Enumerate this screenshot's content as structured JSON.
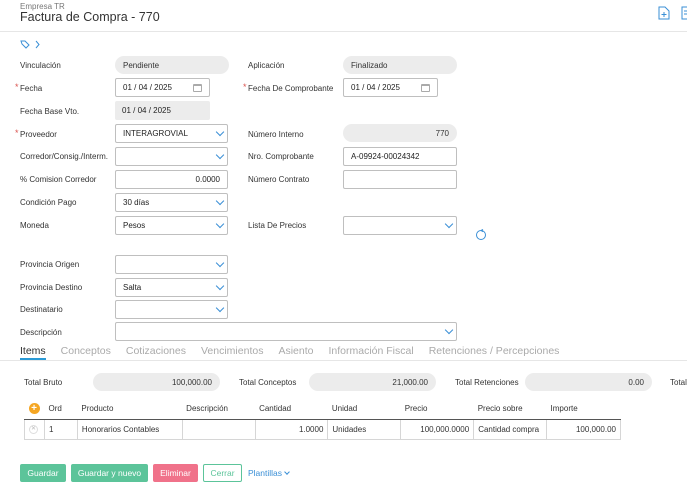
{
  "header": {
    "company": "Empresa TR",
    "title": "Factura de Compra - 770"
  },
  "form": {
    "vinculacion": {
      "label": "Vinculación",
      "value": "Pendiente"
    },
    "aplicacion": {
      "label": "Aplicación",
      "value": "Finalizado"
    },
    "fecha": {
      "label": "Fecha",
      "value": "01 / 04 / 2025"
    },
    "fecha_comprobante": {
      "label": "Fecha De Comprobante",
      "value": "01 / 04 / 2025"
    },
    "fecha_base_vto": {
      "label": "Fecha Base Vto.",
      "value": "01 / 04 / 2025"
    },
    "proveedor": {
      "label": "Proveedor",
      "value": "INTERAGROVIAL"
    },
    "numero_interno": {
      "label": "Número Interno",
      "value": "770"
    },
    "corredor": {
      "label": "Corredor/Consig./Interm.",
      "value": ""
    },
    "nro_comprobante": {
      "label": "Nro. Comprobante",
      "value": "A-09924-00024342"
    },
    "comision_corredor": {
      "label": "% Comision Corredor",
      "value": "0.0000"
    },
    "numero_contrato": {
      "label": "Número Contrato",
      "value": ""
    },
    "condicion_pago": {
      "label": "Condición Pago",
      "value": "30 días"
    },
    "moneda": {
      "label": "Moneda",
      "value": "Pesos"
    },
    "lista_precios": {
      "label": "Lista De Precios",
      "value": ""
    },
    "provincia_origen": {
      "label": "Provincia Origen",
      "value": ""
    },
    "provincia_destino": {
      "label": "Provincia Destino",
      "value": "Salta"
    },
    "destinatario": {
      "label": "Destinatario",
      "value": ""
    },
    "descripcion": {
      "label": "Descripción",
      "value": ""
    }
  },
  "tabs": [
    "Items",
    "Conceptos",
    "Cotizaciones",
    "Vencimientos",
    "Asiento",
    "Información Fiscal",
    "Retenciones / Percepciones"
  ],
  "totals": {
    "bruto": {
      "label": "Total Bruto",
      "value": "100,000.00"
    },
    "conceptos": {
      "label": "Total Conceptos",
      "value": "21,000.00"
    },
    "retenciones": {
      "label": "Total Retenciones",
      "value": "0.00"
    },
    "total": {
      "label": "Total",
      "value": ""
    }
  },
  "items_table": {
    "columns": [
      "Ord",
      "Producto",
      "Descripción",
      "Cantidad",
      "Unidad",
      "Precio",
      "Precio sobre",
      "Importe"
    ],
    "rows": [
      {
        "ord": "1",
        "producto": "Honorarios Contables",
        "descripcion": "",
        "cantidad": "1.0000",
        "unidad": "Unidades",
        "precio": "100,000.0000",
        "precio_sobre": "Cantidad compra",
        "importe": "100,000.00"
      }
    ]
  },
  "actions": {
    "guardar": "Guardar",
    "guardar_nuevo": "Guardar y nuevo",
    "eliminar": "Eliminar",
    "cerrar": "Cerrar",
    "plantillas": "Plantillas"
  },
  "colors": {
    "accent": "#2a9ad6",
    "green": "#5cc49a",
    "red": "#f0728a",
    "add": "#f5a623"
  }
}
